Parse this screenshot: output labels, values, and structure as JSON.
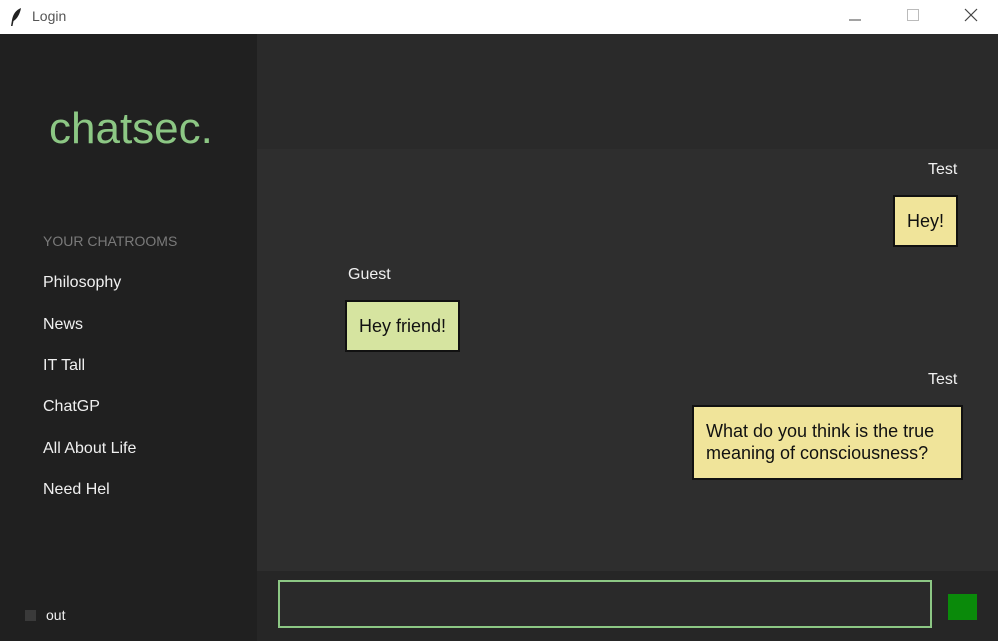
{
  "window": {
    "title": "Login",
    "icons": {
      "app": "feather-icon",
      "minimize": "minimize-icon",
      "maximize": "maximize-icon",
      "close": "close-icon"
    }
  },
  "sidebar": {
    "brand": "chatsec.",
    "section_title": "YOUR CHATROOMS",
    "rooms": [
      {
        "label": "Philosophy"
      },
      {
        "label": "News"
      },
      {
        "label": "IT Tall"
      },
      {
        "label": "ChatGP"
      },
      {
        "label": "All About Life"
      },
      {
        "label": "Need Hel"
      }
    ],
    "logout_label": "out"
  },
  "chat": {
    "messages": [
      {
        "sender": "Test",
        "text": "Hey!",
        "mine": true
      },
      {
        "sender": "Guest",
        "text": "Hey friend!",
        "mine": false
      },
      {
        "sender": "Test",
        "line1": "What do you think is the true",
        "line2": "meaning of consciousness?",
        "mine": true
      }
    ]
  },
  "composer": {
    "value": "",
    "placeholder": ""
  },
  "colors": {
    "brand": "#8cc784",
    "own_bubble": "#f0e49a",
    "other_bubble": "#d6e4a0",
    "send_button": "#0a8a0a"
  }
}
